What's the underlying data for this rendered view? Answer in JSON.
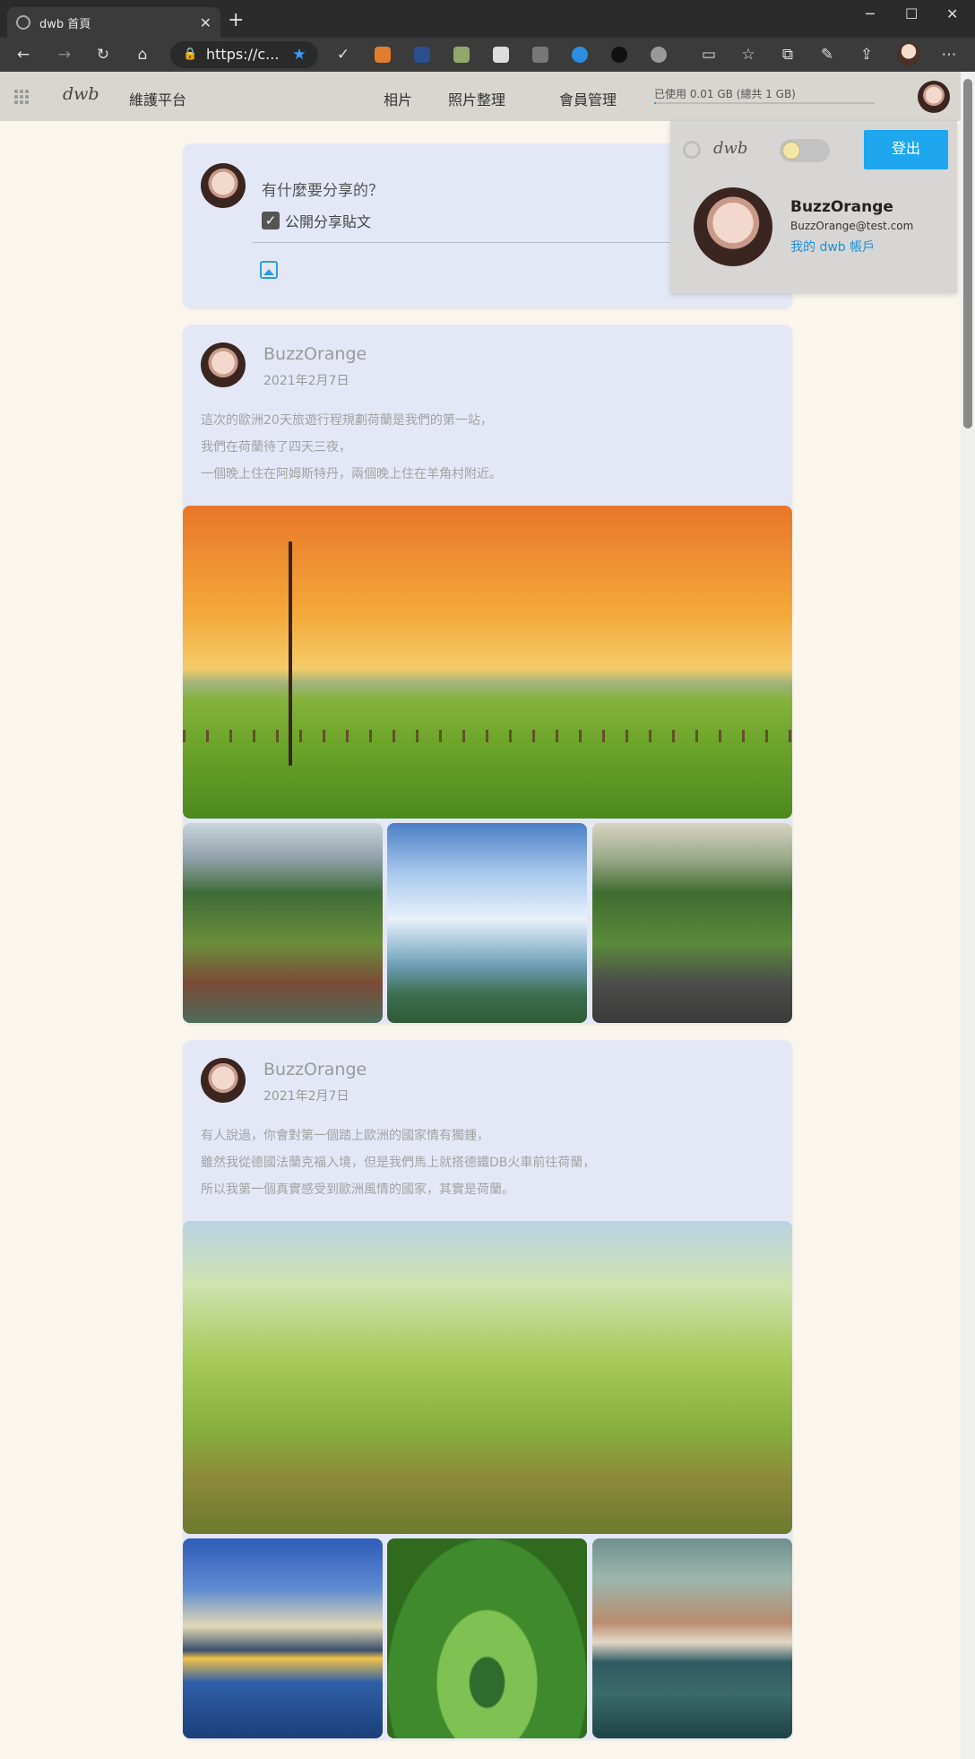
{
  "browser": {
    "tab_title": "dwb 首頁",
    "url": "https://c...",
    "new_tab": "+",
    "close_tab": "✕"
  },
  "navbar": {
    "logo": "dwb",
    "brand": "維護平台",
    "links": [
      "相片",
      "照片整理",
      "會員管理"
    ],
    "usage_text": "已使用 0.01 GB (總共 1 GB)",
    "usage_fraction": 0.01
  },
  "composer": {
    "prompt": "有什麼要分享的？",
    "public_label": "公開分享貼文"
  },
  "panel": {
    "logo": "dwb",
    "logout": "登出",
    "name": "BuzzOrange",
    "email": "BuzzOrange@test.com",
    "account_link": "我的 dwb 帳戶"
  },
  "posts": [
    {
      "author": "BuzzOrange",
      "date": "2021年2月7日",
      "lines": [
        "這次的歐洲20天旅遊行程規劃荷蘭是我們的第一站，",
        "我們在荷蘭待了四天三夜，",
        "一個晚上住在阿姆斯特丹，兩個晚上住在羊角村附近。"
      ]
    },
    {
      "author": "BuzzOrange",
      "date": "2021年2月7日",
      "lines": [
        "有人說過，你會對第一個踏上歐洲的國家情有獨鍾，",
        "雖然我從德國法蘭克福入境，但是我們馬上就搭德鐵DB火車前往荷蘭，",
        "所以我第一個真實感受到歐洲風情的國家，其實是荷蘭。"
      ]
    }
  ]
}
